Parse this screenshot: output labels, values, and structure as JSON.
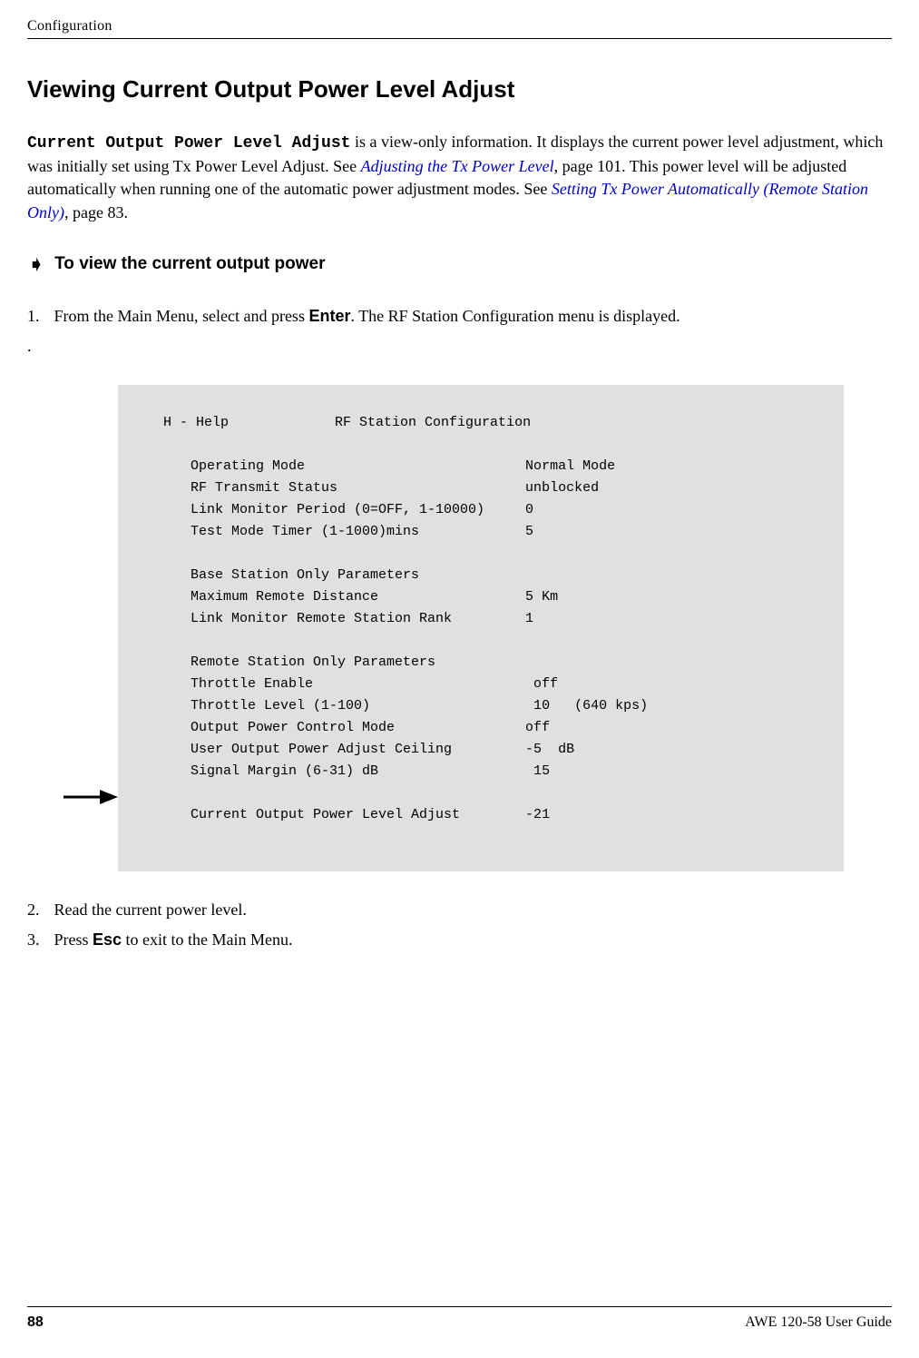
{
  "header": {
    "section": "Configuration"
  },
  "heading": "Viewing Current Output Power Level Adjust",
  "intro": {
    "code_label": "Current Output Power Level Adjust",
    "text1": " is a view-only information. It displays the current power level adjustment, which was initially set using Tx Power Level Adjust. See ",
    "link1": "Adjusting the Tx Power Level",
    "text2": ", page 101. This power level will be adjusted automatically when running one of the automatic power adjustment modes. See ",
    "link2": "Setting Tx Power Automatically (Remote Station Only)",
    "text3": ", page 83."
  },
  "subheading": "To view the current output power",
  "step1": {
    "num": "1.",
    "text1": "From the Main Menu, select and press ",
    "bold1": "Enter",
    "text2": ". The RF Station Configuration menu is displayed."
  },
  "dot": ".",
  "terminal": {
    "title": "H - Help             RF Station Configuration",
    "lines": [
      "Operating Mode                           Normal Mode",
      "RF Transmit Status                       unblocked",
      "Link Monitor Period (0=OFF, 1-10000)     0",
      "Test Mode Timer (1-1000)mins             5",
      "",
      "Base Station Only Parameters",
      "Maximum Remote Distance                  5 Km",
      "Link Monitor Remote Station Rank         1",
      "",
      "Remote Station Only Parameters",
      "Throttle Enable                           off",
      "Throttle Level (1-100)                    10   (640 kps)",
      "Output Power Control Mode                off",
      "User Output Power Adjust Ceiling         -5  dB",
      "Signal Margin (6-31) dB                   15",
      "",
      "Current Output Power Level Adjust        -21"
    ]
  },
  "step2": {
    "num": "2.",
    "text": "Read the current power level."
  },
  "step3": {
    "num": "3.",
    "text1": " Press ",
    "bold1": "Esc",
    "text2": " to exit to the Main Menu."
  },
  "footer": {
    "page": "88",
    "guide": "AWE 120-58 User Guide"
  }
}
